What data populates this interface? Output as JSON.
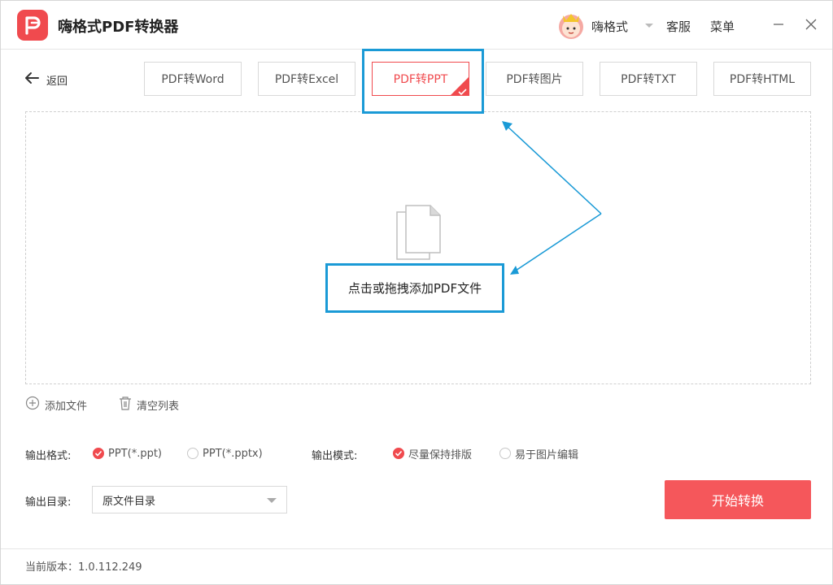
{
  "app": {
    "title": "嗨格式PDF转换器",
    "accent_color": "#f04a4e",
    "logo_icon": "pdf-logo-icon"
  },
  "user": {
    "name": "嗨格式",
    "avatar_icon": "cartoon-avatar-icon"
  },
  "header": {
    "service": "客服",
    "menu": "菜单"
  },
  "nav": {
    "back_label": "返回"
  },
  "tabs": [
    {
      "label": "PDF转Word",
      "active": false
    },
    {
      "label": "PDF转Excel",
      "active": false
    },
    {
      "label": "PDF转PPT",
      "active": true
    },
    {
      "label": "PDF转图片",
      "active": false
    },
    {
      "label": "PDF转TXT",
      "active": false
    },
    {
      "label": "PDF转HTML",
      "active": false
    }
  ],
  "dropzone": {
    "text": "点击或拖拽添加PDF文件",
    "icon": "document-icon"
  },
  "annotation": {
    "color": "#1a9ad6"
  },
  "file_actions": {
    "add_label": "添加文件",
    "clear_label": "清空列表"
  },
  "output": {
    "format_label": "输出格式:",
    "format_options": [
      {
        "label": "PPT(*.ppt)",
        "checked": true
      },
      {
        "label": "PPT(*.pptx)",
        "checked": false
      }
    ],
    "mode_label": "输出模式:",
    "mode_options": [
      {
        "label": "尽量保持排版",
        "checked": true
      },
      {
        "label": "易于图片编辑",
        "checked": false
      }
    ],
    "dir_label": "输出目录:",
    "dir_value": "原文件目录"
  },
  "actions": {
    "start_label": "开始转换"
  },
  "footer": {
    "version": "当前版本：1.0.112.249"
  }
}
